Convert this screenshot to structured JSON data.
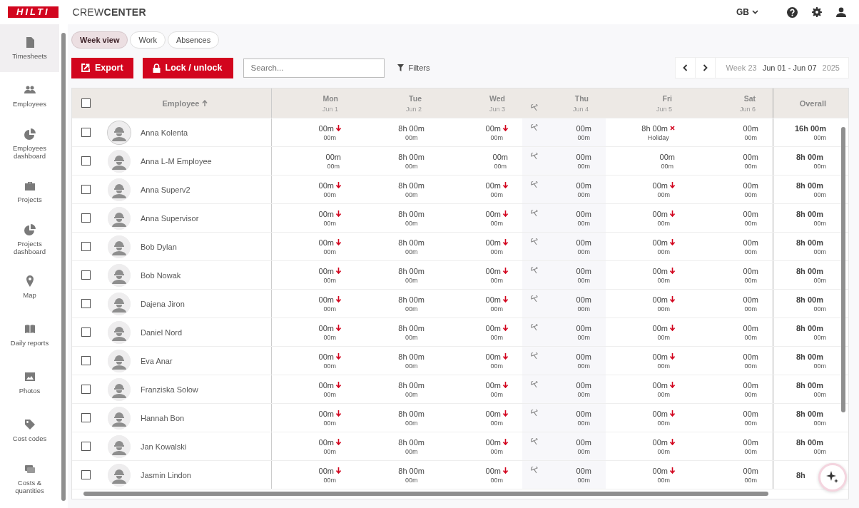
{
  "header": {
    "logo": "HILTI",
    "app_name": "CREW**CENTER**",
    "language": "GB"
  },
  "sidebar": {
    "items": [
      {
        "label": "Timesheets",
        "selected": true
      },
      {
        "label": "Employees",
        "selected": false
      },
      {
        "label": "Employees dashboard",
        "selected": false
      },
      {
        "label": "Projects",
        "selected": false
      },
      {
        "label": "Projects dashboard",
        "selected": false
      },
      {
        "label": "Map",
        "selected": false
      },
      {
        "label": "Daily reports",
        "selected": false
      },
      {
        "label": "Photos",
        "selected": false
      },
      {
        "label": "Cost codes",
        "selected": false
      },
      {
        "label": "Costs & quantities",
        "selected": false
      }
    ]
  },
  "tabs": [
    {
      "label": "Week view",
      "selected": true
    },
    {
      "label": "Work",
      "selected": false
    },
    {
      "label": "Absences",
      "selected": false
    }
  ],
  "toolbar": {
    "export": "Export",
    "lock": "Lock / unlock",
    "search_placeholder": "Search...",
    "filters": "Filters",
    "week": "Week 23",
    "range": "Jun 01 - Jun 07",
    "year": "2025"
  },
  "table": {
    "employee_column": "Employee",
    "overall_column": "Overall",
    "all_checked": false,
    "days": [
      {
        "day": "Mon",
        "date": "Jun 1",
        "holiday": false
      },
      {
        "day": "Tue",
        "date": "Jun 2",
        "holiday": false
      },
      {
        "day": "Wed",
        "date": "Jun 3",
        "holiday": false
      },
      {
        "day": "Thu",
        "date": "Jun 4",
        "holiday": true
      },
      {
        "day": "Fri",
        "date": "Jun 5",
        "holiday": false
      },
      {
        "day": "Sat",
        "date": "Jun 6",
        "holiday": false
      }
    ],
    "rows": [
      {
        "name": "Anna Kolenta",
        "checked": false,
        "cells": [
          {
            "main": "00m",
            "sub": "00m",
            "short": true,
            "absent": false
          },
          {
            "main": "8h 00m",
            "sub": "00m",
            "short": false,
            "absent": false
          },
          {
            "main": "00m",
            "sub": "00m",
            "short": true,
            "absent": false
          },
          {
            "main": "00m",
            "sub": "00m",
            "short": false,
            "absent": false
          },
          {
            "main": "8h 00m",
            "sub": "Holiday",
            "short": false,
            "absent": true
          },
          {
            "main": "00m",
            "sub": "00m",
            "short": false,
            "absent": false
          }
        ],
        "overall": "16h 00m",
        "overall_sub": "00m"
      },
      {
        "name": "Anna L-M Employee",
        "checked": false,
        "cells": [
          {
            "main": "00m",
            "sub": "00m",
            "short": false,
            "absent": false
          },
          {
            "main": "8h 00m",
            "sub": "00m",
            "short": false,
            "absent": false
          },
          {
            "main": "00m",
            "sub": "00m",
            "short": false,
            "absent": false
          },
          {
            "main": "00m",
            "sub": "00m",
            "short": false,
            "absent": false
          },
          {
            "main": "00m",
            "sub": "00m",
            "short": false,
            "absent": false
          },
          {
            "main": "00m",
            "sub": "00m",
            "short": false,
            "absent": false
          }
        ],
        "overall": "8h 00m",
        "overall_sub": "00m"
      },
      {
        "name": "Anna Superv2",
        "checked": false,
        "cells": [
          {
            "main": "00m",
            "sub": "00m",
            "short": true,
            "absent": false
          },
          {
            "main": "8h 00m",
            "sub": "00m",
            "short": false,
            "absent": false
          },
          {
            "main": "00m",
            "sub": "00m",
            "short": true,
            "absent": false
          },
          {
            "main": "00m",
            "sub": "00m",
            "short": false,
            "absent": false
          },
          {
            "main": "00m",
            "sub": "00m",
            "short": true,
            "absent": false
          },
          {
            "main": "00m",
            "sub": "00m",
            "short": false,
            "absent": false
          }
        ],
        "overall": "8h 00m",
        "overall_sub": "00m"
      },
      {
        "name": "Anna Supervisor",
        "checked": false,
        "cells": [
          {
            "main": "00m",
            "sub": "00m",
            "short": true,
            "absent": false
          },
          {
            "main": "8h 00m",
            "sub": "00m",
            "short": false,
            "absent": false
          },
          {
            "main": "00m",
            "sub": "00m",
            "short": true,
            "absent": false
          },
          {
            "main": "00m",
            "sub": "00m",
            "short": false,
            "absent": false
          },
          {
            "main": "00m",
            "sub": "00m",
            "short": true,
            "absent": false
          },
          {
            "main": "00m",
            "sub": "00m",
            "short": false,
            "absent": false
          }
        ],
        "overall": "8h 00m",
        "overall_sub": "00m"
      },
      {
        "name": "Bob Dylan",
        "checked": false,
        "cells": [
          {
            "main": "00m",
            "sub": "00m",
            "short": true,
            "absent": false
          },
          {
            "main": "8h 00m",
            "sub": "00m",
            "short": false,
            "absent": false
          },
          {
            "main": "00m",
            "sub": "00m",
            "short": true,
            "absent": false
          },
          {
            "main": "00m",
            "sub": "00m",
            "short": false,
            "absent": false
          },
          {
            "main": "00m",
            "sub": "00m",
            "short": true,
            "absent": false
          },
          {
            "main": "00m",
            "sub": "00m",
            "short": false,
            "absent": false
          }
        ],
        "overall": "8h 00m",
        "overall_sub": "00m"
      },
      {
        "name": "Bob Nowak",
        "checked": false,
        "cells": [
          {
            "main": "00m",
            "sub": "00m",
            "short": true,
            "absent": false
          },
          {
            "main": "8h 00m",
            "sub": "00m",
            "short": false,
            "absent": false
          },
          {
            "main": "00m",
            "sub": "00m",
            "short": true,
            "absent": false
          },
          {
            "main": "00m",
            "sub": "00m",
            "short": false,
            "absent": false
          },
          {
            "main": "00m",
            "sub": "00m",
            "short": true,
            "absent": false
          },
          {
            "main": "00m",
            "sub": "00m",
            "short": false,
            "absent": false
          }
        ],
        "overall": "8h 00m",
        "overall_sub": "00m"
      },
      {
        "name": "Dajena Jiron",
        "checked": false,
        "cells": [
          {
            "main": "00m",
            "sub": "00m",
            "short": true,
            "absent": false
          },
          {
            "main": "8h 00m",
            "sub": "00m",
            "short": false,
            "absent": false
          },
          {
            "main": "00m",
            "sub": "00m",
            "short": true,
            "absent": false
          },
          {
            "main": "00m",
            "sub": "00m",
            "short": false,
            "absent": false
          },
          {
            "main": "00m",
            "sub": "00m",
            "short": true,
            "absent": false
          },
          {
            "main": "00m",
            "sub": "00m",
            "short": false,
            "absent": false
          }
        ],
        "overall": "8h 00m",
        "overall_sub": "00m"
      },
      {
        "name": "Daniel Nord",
        "checked": false,
        "cells": [
          {
            "main": "00m",
            "sub": "00m",
            "short": true,
            "absent": false
          },
          {
            "main": "8h 00m",
            "sub": "00m",
            "short": false,
            "absent": false
          },
          {
            "main": "00m",
            "sub": "00m",
            "short": true,
            "absent": false
          },
          {
            "main": "00m",
            "sub": "00m",
            "short": false,
            "absent": false
          },
          {
            "main": "00m",
            "sub": "00m",
            "short": true,
            "absent": false
          },
          {
            "main": "00m",
            "sub": "00m",
            "short": false,
            "absent": false
          }
        ],
        "overall": "8h 00m",
        "overall_sub": "00m"
      },
      {
        "name": "Eva Anar",
        "checked": false,
        "cells": [
          {
            "main": "00m",
            "sub": "00m",
            "short": true,
            "absent": false
          },
          {
            "main": "8h 00m",
            "sub": "00m",
            "short": false,
            "absent": false
          },
          {
            "main": "00m",
            "sub": "00m",
            "short": true,
            "absent": false
          },
          {
            "main": "00m",
            "sub": "00m",
            "short": false,
            "absent": false
          },
          {
            "main": "00m",
            "sub": "00m",
            "short": true,
            "absent": false
          },
          {
            "main": "00m",
            "sub": "00m",
            "short": false,
            "absent": false
          }
        ],
        "overall": "8h 00m",
        "overall_sub": "00m"
      },
      {
        "name": "Franziska Solow",
        "checked": false,
        "cells": [
          {
            "main": "00m",
            "sub": "00m",
            "short": true,
            "absent": false
          },
          {
            "main": "8h 00m",
            "sub": "00m",
            "short": false,
            "absent": false
          },
          {
            "main": "00m",
            "sub": "00m",
            "short": true,
            "absent": false
          },
          {
            "main": "00m",
            "sub": "00m",
            "short": false,
            "absent": false
          },
          {
            "main": "00m",
            "sub": "00m",
            "short": true,
            "absent": false
          },
          {
            "main": "00m",
            "sub": "00m",
            "short": false,
            "absent": false
          }
        ],
        "overall": "8h 00m",
        "overall_sub": "00m"
      },
      {
        "name": "Hannah Bon",
        "checked": false,
        "cells": [
          {
            "main": "00m",
            "sub": "00m",
            "short": true,
            "absent": false
          },
          {
            "main": "8h 00m",
            "sub": "00m",
            "short": false,
            "absent": false
          },
          {
            "main": "00m",
            "sub": "00m",
            "short": true,
            "absent": false
          },
          {
            "main": "00m",
            "sub": "00m",
            "short": false,
            "absent": false
          },
          {
            "main": "00m",
            "sub": "00m",
            "short": true,
            "absent": false
          },
          {
            "main": "00m",
            "sub": "00m",
            "short": false,
            "absent": false
          }
        ],
        "overall": "8h 00m",
        "overall_sub": "00m"
      },
      {
        "name": "Jan Kowalski",
        "checked": false,
        "cells": [
          {
            "main": "00m",
            "sub": "00m",
            "short": true,
            "absent": false
          },
          {
            "main": "8h 00m",
            "sub": "00m",
            "short": false,
            "absent": false
          },
          {
            "main": "00m",
            "sub": "00m",
            "short": true,
            "absent": false
          },
          {
            "main": "00m",
            "sub": "00m",
            "short": false,
            "absent": false
          },
          {
            "main": "00m",
            "sub": "00m",
            "short": true,
            "absent": false
          },
          {
            "main": "00m",
            "sub": "00m",
            "short": false,
            "absent": false
          }
        ],
        "overall": "8h 00m",
        "overall_sub": "00m"
      },
      {
        "name": "Jasmin Lindon",
        "checked": false,
        "cells": [
          {
            "main": "00m",
            "sub": "00m",
            "short": true,
            "absent": false
          },
          {
            "main": "8h 00m",
            "sub": "00m",
            "short": false,
            "absent": false
          },
          {
            "main": "00m",
            "sub": "00m",
            "short": true,
            "absent": false
          },
          {
            "main": "00m",
            "sub": "00m",
            "short": false,
            "absent": false
          },
          {
            "main": "00m",
            "sub": "00m",
            "short": true,
            "absent": false
          },
          {
            "main": "00m",
            "sub": "00m",
            "short": false,
            "absent": false
          }
        ],
        "overall": "8h"
      }
    ]
  }
}
